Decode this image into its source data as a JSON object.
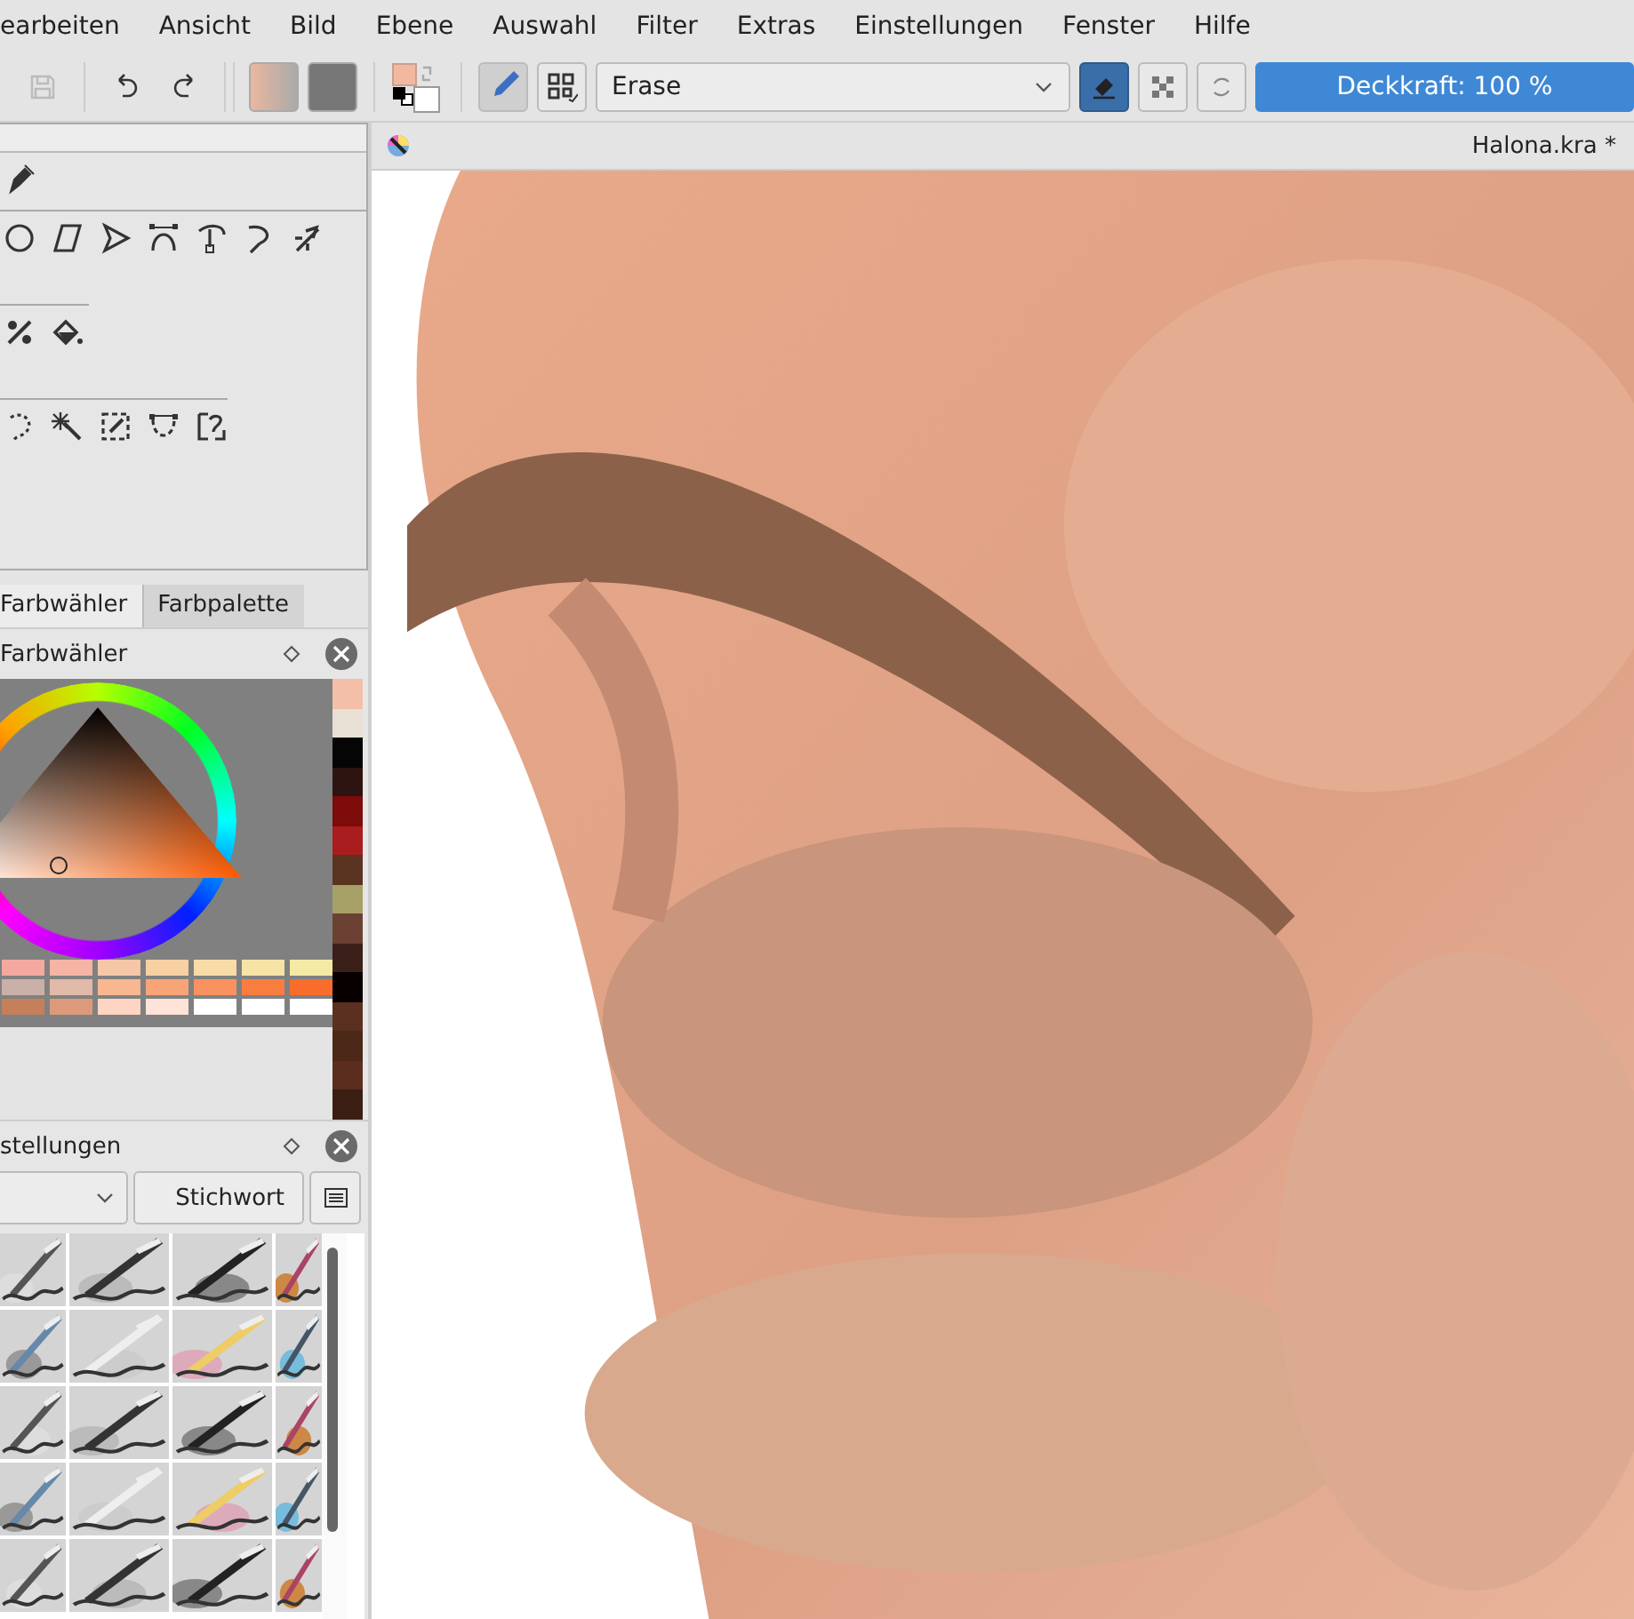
{
  "menu": [
    "earbeiten",
    "Ansicht",
    "Bild",
    "Ebene",
    "Auswahl",
    "Filter",
    "Extras",
    "Einstellungen",
    "Fenster",
    "Hilfe"
  ],
  "toolbar": {
    "save_disabled": true,
    "brush_mode": "Erase",
    "eraser_mode": {
      "on": true
    },
    "preserve_alpha": {
      "on": false
    },
    "opacity": {
      "label": "Deckkraft: 100 %",
      "level": 1
    }
  },
  "document": {
    "title": "Halona.kra *"
  },
  "dock_tabs": [
    {
      "label": "Farbwähler",
      "selected": true
    },
    {
      "label": "Farbpalette",
      "selected": false
    }
  ],
  "color_dock": {
    "title": "Farbwähler",
    "swatches": [
      {
        "color": "#f4a9a0"
      },
      {
        "color": "#f5b4a5"
      },
      {
        "color": "#f6c6a8"
      },
      {
        "color": "#f7d0a4"
      },
      {
        "color": "#f7dca8"
      },
      {
        "color": "#f6e3a6"
      },
      {
        "color": "#f5eaa5"
      },
      {
        "color": "#c9b0a8"
      },
      {
        "color": "#e0b9a8"
      },
      {
        "color": "#f9b791"
      },
      {
        "color": "#f9a477"
      },
      {
        "color": "#f8925e"
      },
      {
        "color": "#f97d3f"
      },
      {
        "color": "#f86d2c"
      },
      {
        "color": "#c57f5a"
      },
      {
        "color": "#dc9a7b"
      },
      {
        "color": "#fdd5c2"
      },
      {
        "color": "#fde3d8"
      },
      {
        "color": "#ffffff"
      },
      {
        "color": "#ffffff"
      },
      {
        "color": "#ffffff"
      }
    ],
    "history": [
      {
        "color": "#f4bfa8"
      },
      {
        "color": "#e8e0d4"
      },
      {
        "color": "#050505"
      },
      {
        "color": "#2d1410"
      },
      {
        "color": "#7c0b0a"
      },
      {
        "color": "#a91d1e"
      },
      {
        "color": "#5b3321"
      },
      {
        "color": "#a7a066"
      },
      {
        "color": "#6a4133"
      },
      {
        "color": "#3a2018"
      },
      {
        "color": "#080000"
      },
      {
        "color": "#5a3020"
      },
      {
        "color": "#4c2818"
      },
      {
        "color": "#5a2d1e"
      },
      {
        "color": "#3b1e14"
      }
    ]
  },
  "brush_dock": {
    "title": "stellungen",
    "tag_button": "Stichwort"
  }
}
